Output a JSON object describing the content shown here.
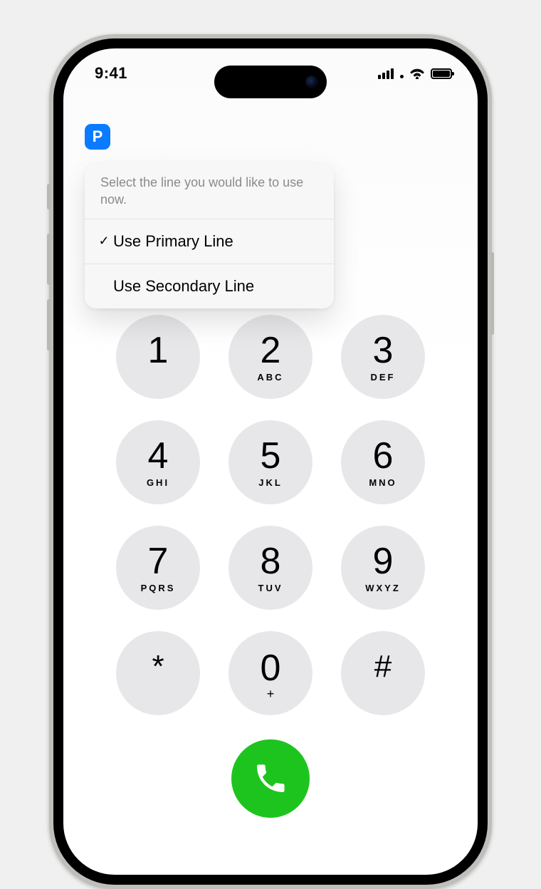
{
  "status": {
    "time": "9:41"
  },
  "line_badge": "P",
  "popover": {
    "header": "Select the line you would like to use now.",
    "items": [
      {
        "label": "Use Primary Line",
        "checked": true
      },
      {
        "label": "Use Secondary Line",
        "checked": false
      }
    ]
  },
  "keypad": {
    "keys": [
      {
        "digit": "1",
        "letters": ""
      },
      {
        "digit": "2",
        "letters": "ABC"
      },
      {
        "digit": "3",
        "letters": "DEF"
      },
      {
        "digit": "4",
        "letters": "GHI"
      },
      {
        "digit": "5",
        "letters": "JKL"
      },
      {
        "digit": "6",
        "letters": "MNO"
      },
      {
        "digit": "7",
        "letters": "PQRS"
      },
      {
        "digit": "8",
        "letters": "TUV"
      },
      {
        "digit": "9",
        "letters": "WXYZ"
      },
      {
        "digit": "*",
        "letters": ""
      },
      {
        "digit": "0",
        "letters": "+"
      },
      {
        "digit": "#",
        "letters": ""
      }
    ]
  }
}
